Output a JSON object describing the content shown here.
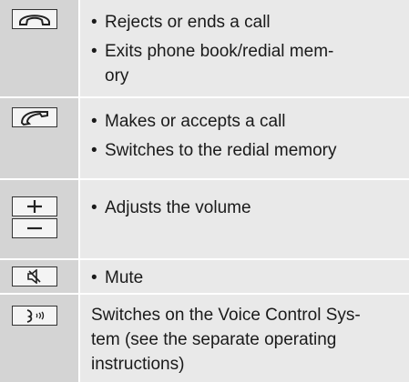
{
  "rows": [
    {
      "icon": "end-call-icon",
      "bullets": [
        "Rejects or ends a call",
        "Exits phone book/redial mem-ory"
      ]
    },
    {
      "icon": "call-icon",
      "bullets": [
        "Makes or accepts a call",
        "Switches to the redial memory"
      ]
    },
    {
      "icon": "volume-plus-minus-icon",
      "bullets": [
        "Adjusts the volume"
      ]
    },
    {
      "icon": "mute-icon",
      "bullets": [
        "Mute"
      ]
    },
    {
      "icon": "voice-control-icon",
      "text": "Switches on the Voice Control Sys-tem (see the separate operating instructions)"
    }
  ]
}
